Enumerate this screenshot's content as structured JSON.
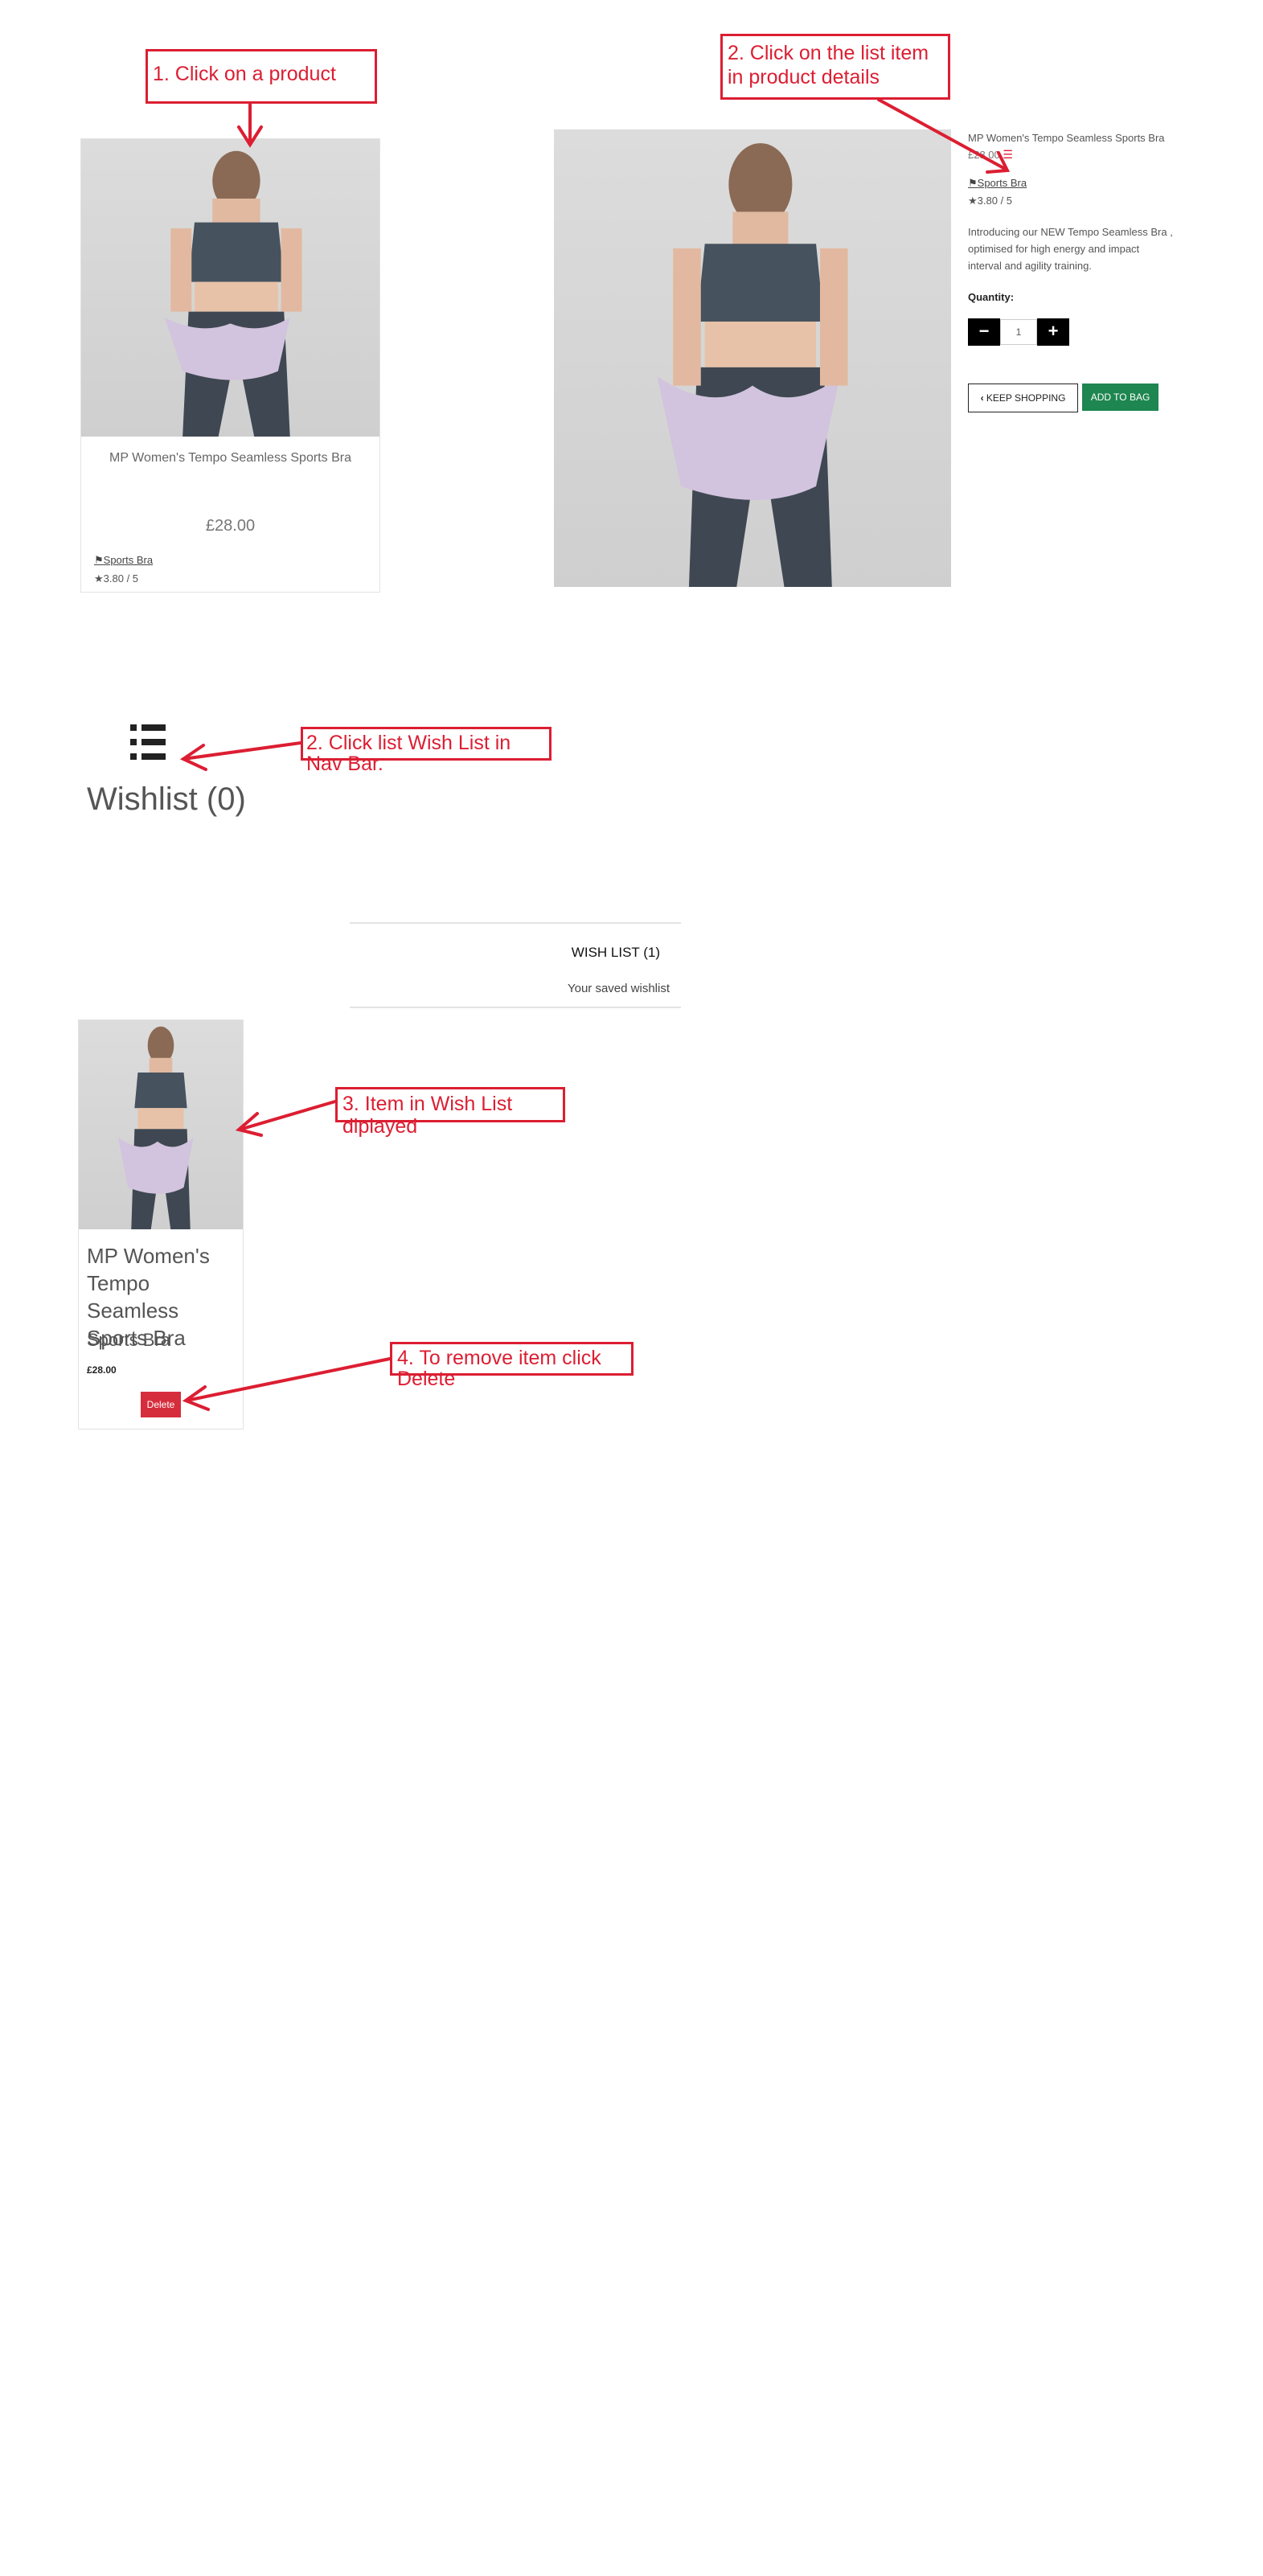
{
  "colors": {
    "annotation": "#dc1e32",
    "add_to_bag": "#1e8650",
    "delete": "#d62d3c"
  },
  "annotations": {
    "step1": "1. Click on a product",
    "step2a": "2. Click on the list item in product details",
    "step2b": "2. Click list Wish List in Nav Bar.",
    "step3": "3. Item in Wish List diplayed",
    "step4": "4. To remove item click Delete"
  },
  "product_card": {
    "title": "MP Women's Tempo Seamless Sports Bra",
    "price": "£28.00",
    "category": "Sports Bra",
    "rating": "3.80 / 5",
    "tag_icon": "tag-icon",
    "star_icon": "star-icon"
  },
  "product_detail": {
    "title": "MP Women's Tempo Seamless Sports Bra",
    "price": "£28.00",
    "category": "Sports Bra",
    "rating": "3.80 / 5",
    "description": "Introducing our NEW Tempo Seamless Bra , optimised for high energy and impact interval and agility training.",
    "quantity_label": "Quantity:",
    "quantity_value": "1",
    "minus": "−",
    "plus": "+",
    "keep_shopping": "KEEP SHOPPING",
    "add_to_bag": "ADD TO BAG",
    "wishlist_icon": "list-icon"
  },
  "nav": {
    "wishlist_label": "Wishlist (0)",
    "wishlist_icon": "list-icon"
  },
  "wishlist_page": {
    "title": "WISH LIST (1)",
    "subtitle": "Your saved wishlist",
    "item": {
      "name": "MP Women's Tempo Seamless Sports Bra",
      "category": "Sports Bra",
      "price": "£28.00",
      "delete": "Delete"
    }
  }
}
